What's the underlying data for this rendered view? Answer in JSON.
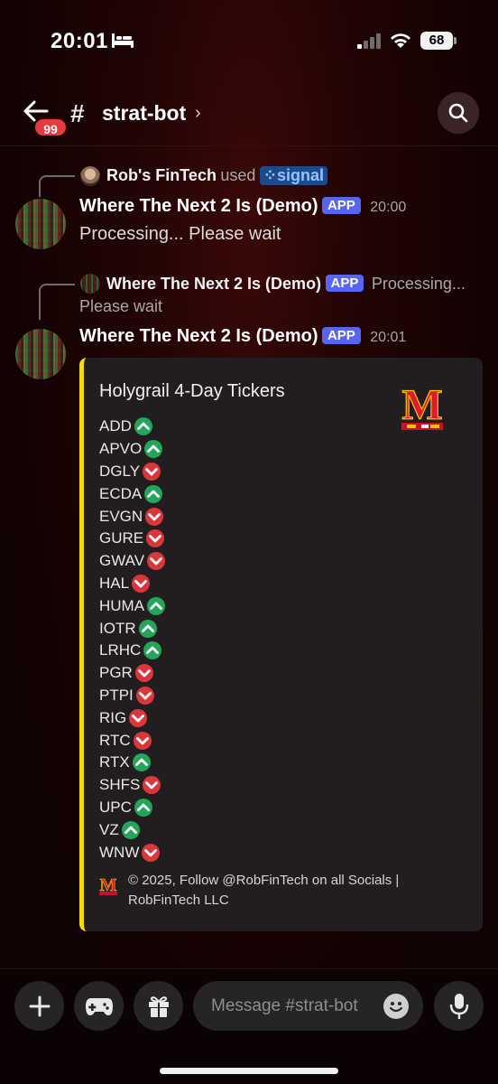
{
  "status_bar": {
    "time": "20:01",
    "battery": "68"
  },
  "header": {
    "unread_count": "99",
    "channel_name": "strat-bot"
  },
  "messages": {
    "interaction": {
      "user": "Rob's FinTech",
      "verb": "used",
      "command": "signal"
    },
    "first": {
      "author": "Where The Next 2 Is (Demo)",
      "badge": "APP",
      "time": "20:00",
      "text": "Processing... Please wait"
    },
    "reply": {
      "author": "Where The Next 2 Is (Demo)",
      "badge": "APP",
      "preview_line1": "Processing...",
      "preview_line2": "Please wait"
    },
    "second": {
      "author": "Where The Next 2 Is (Demo)",
      "badge": "APP",
      "time": "20:01"
    }
  },
  "embed": {
    "accent_color": "#f5d90a",
    "title": "Holygrail 4-Day Tickers",
    "logo_letter": "M",
    "tickers": [
      {
        "symbol": "ADD",
        "direction": "up"
      },
      {
        "symbol": "APVO",
        "direction": "up"
      },
      {
        "symbol": "DGLY",
        "direction": "down"
      },
      {
        "symbol": "ECDA",
        "direction": "up"
      },
      {
        "symbol": "EVGN",
        "direction": "down"
      },
      {
        "symbol": "GURE",
        "direction": "down"
      },
      {
        "symbol": "GWAV",
        "direction": "down"
      },
      {
        "symbol": "HAL",
        "direction": "down"
      },
      {
        "symbol": "HUMA",
        "direction": "up"
      },
      {
        "symbol": "IOTR",
        "direction": "up"
      },
      {
        "symbol": "LRHC",
        "direction": "up"
      },
      {
        "symbol": "PGR",
        "direction": "down"
      },
      {
        "symbol": "PTPI",
        "direction": "down"
      },
      {
        "symbol": "RIG",
        "direction": "down"
      },
      {
        "symbol": "RTC",
        "direction": "down"
      },
      {
        "symbol": "RTX",
        "direction": "up"
      },
      {
        "symbol": "SHFS",
        "direction": "down"
      },
      {
        "symbol": "UPC",
        "direction": "up"
      },
      {
        "symbol": "VZ",
        "direction": "up"
      },
      {
        "symbol": "WNW",
        "direction": "down"
      }
    ],
    "footer_line1": "© 2025, Follow  @RobFinTech on all Socials |",
    "footer_line2": "RobFinTech LLC"
  },
  "composer": {
    "placeholder": "Message #strat-bot"
  },
  "colors": {
    "up": "#23a55a",
    "down": "#da373c",
    "app_badge": "#5865f2"
  }
}
